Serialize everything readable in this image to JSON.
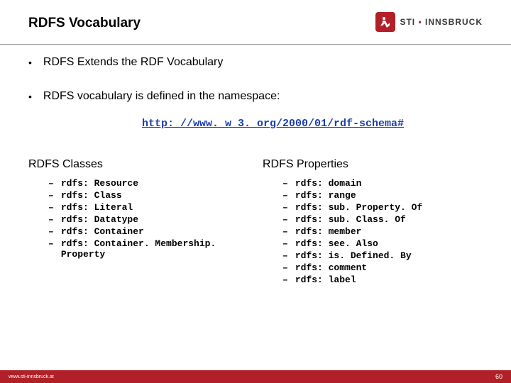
{
  "header": {
    "title": "RDFS Vocabulary",
    "logo_label": "STI",
    "logo_suffix": "INNSBRUCK"
  },
  "bullets": [
    "RDFS Extends the RDF Vocabulary",
    "RDFS vocabulary is defined in the namespace:"
  ],
  "namespace_url": "http: //www. w 3. org/2000/01/rdf-schema#",
  "classes_heading": "RDFS Classes",
  "classes": [
    "rdfs: Resource",
    "rdfs: Class",
    "rdfs: Literal",
    "rdfs: Datatype",
    "rdfs: Container",
    "rdfs: Container. Membership. Property"
  ],
  "properties_heading": "RDFS Properties",
  "properties": [
    "rdfs: domain",
    "rdfs: range",
    "rdfs: sub. Property. Of",
    "rdfs: sub. Class. Of",
    "rdfs: member",
    "rdfs: see. Also",
    "rdfs: is. Defined. By",
    "rdfs: comment",
    "rdfs: label"
  ],
  "footer": {
    "url": "www.sti-innsbruck.at",
    "page": "60"
  }
}
